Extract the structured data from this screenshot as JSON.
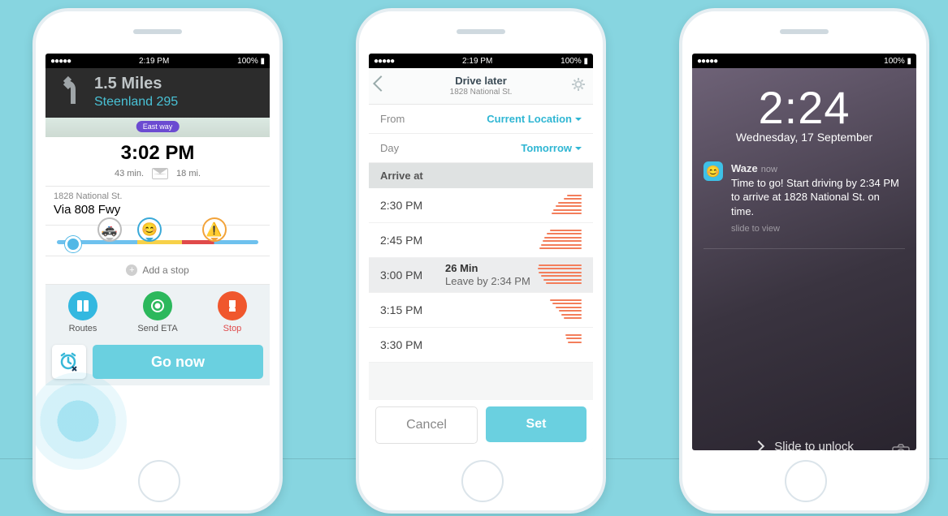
{
  "status_bar": {
    "time": "2:19 PM",
    "battery": "100%",
    "signal": "●●●●●",
    "wifi": "wifi-icon"
  },
  "phone1": {
    "nav": {
      "distance": "1.5 Miles",
      "road": "Steenland 295"
    },
    "map_label": "East way",
    "eta": {
      "time": "3:02 PM",
      "duration": "43 min.",
      "distance": "18 mi."
    },
    "destination": {
      "address": "1828 National St.",
      "via": "Via 808 Fwy"
    },
    "add_stop_label": "Add a stop",
    "actions": {
      "routes": "Routes",
      "send_eta": "Send ETA",
      "stop": "Stop"
    },
    "go_now_label": "Go now"
  },
  "phone2": {
    "header": {
      "title": "Drive later",
      "subtitle": "1828 National St."
    },
    "from": {
      "label": "From",
      "value": "Current Location"
    },
    "day": {
      "label": "Day",
      "value": "Tomorrow"
    },
    "arrive_label": "Arrive at",
    "times": [
      "2:30 PM",
      "2:45 PM",
      "3:00 PM",
      "3:15 PM",
      "3:30 PM"
    ],
    "selected": {
      "time": "3:00 PM",
      "duration": "26 Min",
      "leave": "Leave by 2:34 PM"
    },
    "cancel_label": "Cancel",
    "set_label": "Set"
  },
  "phone3": {
    "clock": {
      "time": "2:24",
      "date": "Wednesday, 17 September"
    },
    "notification": {
      "app": "Waze",
      "when": "now",
      "body": "Time to go! Start driving by 2:34 PM to arrive at 1828 National St. on time.",
      "hint": "slide to view"
    },
    "unlock_label": "Slide to unlock"
  }
}
